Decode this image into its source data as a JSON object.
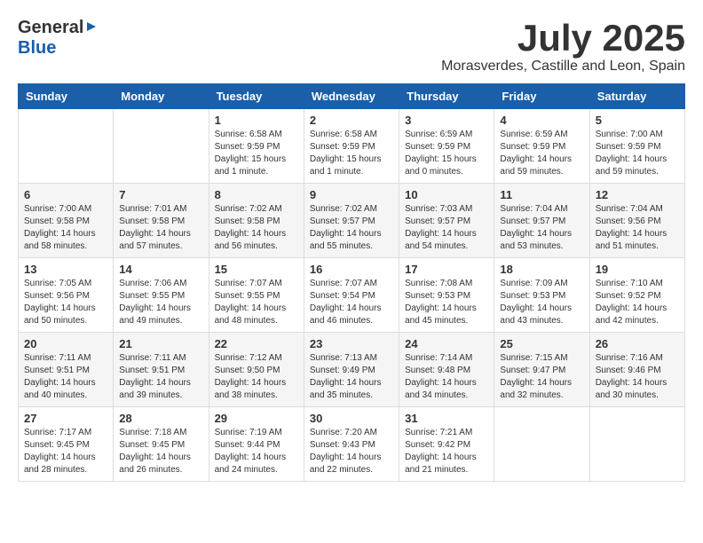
{
  "logo": {
    "general": "General",
    "blue": "Blue"
  },
  "title": {
    "month_year": "July 2025",
    "location": "Morasverdes, Castille and Leon, Spain"
  },
  "days_of_week": [
    "Sunday",
    "Monday",
    "Tuesday",
    "Wednesday",
    "Thursday",
    "Friday",
    "Saturday"
  ],
  "weeks": [
    [
      {
        "day": "",
        "sunrise": "",
        "sunset": "",
        "daylight": ""
      },
      {
        "day": "",
        "sunrise": "",
        "sunset": "",
        "daylight": ""
      },
      {
        "day": "1",
        "sunrise": "Sunrise: 6:58 AM",
        "sunset": "Sunset: 9:59 PM",
        "daylight": "Daylight: 15 hours and 1 minute."
      },
      {
        "day": "2",
        "sunrise": "Sunrise: 6:58 AM",
        "sunset": "Sunset: 9:59 PM",
        "daylight": "Daylight: 15 hours and 1 minute."
      },
      {
        "day": "3",
        "sunrise": "Sunrise: 6:59 AM",
        "sunset": "Sunset: 9:59 PM",
        "daylight": "Daylight: 15 hours and 0 minutes."
      },
      {
        "day": "4",
        "sunrise": "Sunrise: 6:59 AM",
        "sunset": "Sunset: 9:59 PM",
        "daylight": "Daylight: 14 hours and 59 minutes."
      },
      {
        "day": "5",
        "sunrise": "Sunrise: 7:00 AM",
        "sunset": "Sunset: 9:59 PM",
        "daylight": "Daylight: 14 hours and 59 minutes."
      }
    ],
    [
      {
        "day": "6",
        "sunrise": "Sunrise: 7:00 AM",
        "sunset": "Sunset: 9:58 PM",
        "daylight": "Daylight: 14 hours and 58 minutes."
      },
      {
        "day": "7",
        "sunrise": "Sunrise: 7:01 AM",
        "sunset": "Sunset: 9:58 PM",
        "daylight": "Daylight: 14 hours and 57 minutes."
      },
      {
        "day": "8",
        "sunrise": "Sunrise: 7:02 AM",
        "sunset": "Sunset: 9:58 PM",
        "daylight": "Daylight: 14 hours and 56 minutes."
      },
      {
        "day": "9",
        "sunrise": "Sunrise: 7:02 AM",
        "sunset": "Sunset: 9:57 PM",
        "daylight": "Daylight: 14 hours and 55 minutes."
      },
      {
        "day": "10",
        "sunrise": "Sunrise: 7:03 AM",
        "sunset": "Sunset: 9:57 PM",
        "daylight": "Daylight: 14 hours and 54 minutes."
      },
      {
        "day": "11",
        "sunrise": "Sunrise: 7:04 AM",
        "sunset": "Sunset: 9:57 PM",
        "daylight": "Daylight: 14 hours and 53 minutes."
      },
      {
        "day": "12",
        "sunrise": "Sunrise: 7:04 AM",
        "sunset": "Sunset: 9:56 PM",
        "daylight": "Daylight: 14 hours and 51 minutes."
      }
    ],
    [
      {
        "day": "13",
        "sunrise": "Sunrise: 7:05 AM",
        "sunset": "Sunset: 9:56 PM",
        "daylight": "Daylight: 14 hours and 50 minutes."
      },
      {
        "day": "14",
        "sunrise": "Sunrise: 7:06 AM",
        "sunset": "Sunset: 9:55 PM",
        "daylight": "Daylight: 14 hours and 49 minutes."
      },
      {
        "day": "15",
        "sunrise": "Sunrise: 7:07 AM",
        "sunset": "Sunset: 9:55 PM",
        "daylight": "Daylight: 14 hours and 48 minutes."
      },
      {
        "day": "16",
        "sunrise": "Sunrise: 7:07 AM",
        "sunset": "Sunset: 9:54 PM",
        "daylight": "Daylight: 14 hours and 46 minutes."
      },
      {
        "day": "17",
        "sunrise": "Sunrise: 7:08 AM",
        "sunset": "Sunset: 9:53 PM",
        "daylight": "Daylight: 14 hours and 45 minutes."
      },
      {
        "day": "18",
        "sunrise": "Sunrise: 7:09 AM",
        "sunset": "Sunset: 9:53 PM",
        "daylight": "Daylight: 14 hours and 43 minutes."
      },
      {
        "day": "19",
        "sunrise": "Sunrise: 7:10 AM",
        "sunset": "Sunset: 9:52 PM",
        "daylight": "Daylight: 14 hours and 42 minutes."
      }
    ],
    [
      {
        "day": "20",
        "sunrise": "Sunrise: 7:11 AM",
        "sunset": "Sunset: 9:51 PM",
        "daylight": "Daylight: 14 hours and 40 minutes."
      },
      {
        "day": "21",
        "sunrise": "Sunrise: 7:11 AM",
        "sunset": "Sunset: 9:51 PM",
        "daylight": "Daylight: 14 hours and 39 minutes."
      },
      {
        "day": "22",
        "sunrise": "Sunrise: 7:12 AM",
        "sunset": "Sunset: 9:50 PM",
        "daylight": "Daylight: 14 hours and 38 minutes."
      },
      {
        "day": "23",
        "sunrise": "Sunrise: 7:13 AM",
        "sunset": "Sunset: 9:49 PM",
        "daylight": "Daylight: 14 hours and 35 minutes."
      },
      {
        "day": "24",
        "sunrise": "Sunrise: 7:14 AM",
        "sunset": "Sunset: 9:48 PM",
        "daylight": "Daylight: 14 hours and 34 minutes."
      },
      {
        "day": "25",
        "sunrise": "Sunrise: 7:15 AM",
        "sunset": "Sunset: 9:47 PM",
        "daylight": "Daylight: 14 hours and 32 minutes."
      },
      {
        "day": "26",
        "sunrise": "Sunrise: 7:16 AM",
        "sunset": "Sunset: 9:46 PM",
        "daylight": "Daylight: 14 hours and 30 minutes."
      }
    ],
    [
      {
        "day": "27",
        "sunrise": "Sunrise: 7:17 AM",
        "sunset": "Sunset: 9:45 PM",
        "daylight": "Daylight: 14 hours and 28 minutes."
      },
      {
        "day": "28",
        "sunrise": "Sunrise: 7:18 AM",
        "sunset": "Sunset: 9:45 PM",
        "daylight": "Daylight: 14 hours and 26 minutes."
      },
      {
        "day": "29",
        "sunrise": "Sunrise: 7:19 AM",
        "sunset": "Sunset: 9:44 PM",
        "daylight": "Daylight: 14 hours and 24 minutes."
      },
      {
        "day": "30",
        "sunrise": "Sunrise: 7:20 AM",
        "sunset": "Sunset: 9:43 PM",
        "daylight": "Daylight: 14 hours and 22 minutes."
      },
      {
        "day": "31",
        "sunrise": "Sunrise: 7:21 AM",
        "sunset": "Sunset: 9:42 PM",
        "daylight": "Daylight: 14 hours and 21 minutes."
      },
      {
        "day": "",
        "sunrise": "",
        "sunset": "",
        "daylight": ""
      },
      {
        "day": "",
        "sunrise": "",
        "sunset": "",
        "daylight": ""
      }
    ]
  ]
}
